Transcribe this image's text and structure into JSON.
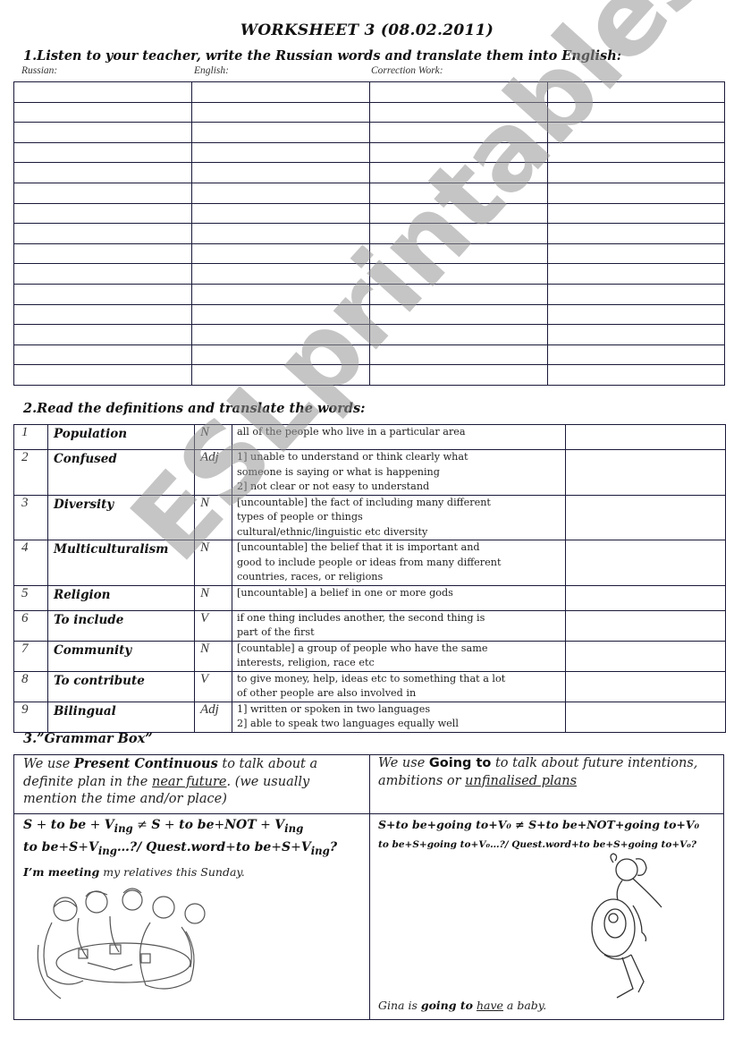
{
  "title": "WORKSHEET 3 (08.02.2011)",
  "section1": {
    "heading": "1.Listen to your teacher, write the Russian words and translate them into English:",
    "column_labels": [
      "Russian:",
      "English:",
      "Correction Work:",
      ""
    ],
    "row_count": 15,
    "column_count": 4
  },
  "section2": {
    "heading": "2.Read the definitions and translate the words:",
    "rows": [
      {
        "num": "1",
        "word": "Population",
        "pos": "N",
        "definition": "all of the people who live in a particular area",
        "translation": ""
      },
      {
        "num": "2",
        "word": "Confused",
        "pos": "Adj",
        "definition": "1] unable to understand or think clearly what\nsomeone is saying or what is happening\n 2] not clear or not easy to understand",
        "translation": ""
      },
      {
        "num": "3",
        "word": "Diversity",
        "pos": "N",
        "definition": " [uncountable] the fact of including many different\ntypes of people or things\ncultural/ethnic/linguistic etc diversity",
        "translation": ""
      },
      {
        "num": "4",
        "word": "Multiculturalism",
        "pos": "N",
        "definition": "[uncountable] the belief that it is important and\ngood to include people or ideas from many different\ncountries, races, or religions",
        "translation": ""
      },
      {
        "num": "5",
        "word": "Religion",
        "pos": "N",
        "definition": " [uncountable] a belief in one or more gods",
        "translation": ""
      },
      {
        "num": "6",
        "word": "To include",
        "pos": "V",
        "definition": "if one thing includes another, the second thing is\npart of the first",
        "translation": ""
      },
      {
        "num": "7",
        "word": "Community",
        "pos": "N",
        "definition": " [countable] a group of people who have the same\ninterests, religion, race etc",
        "translation": ""
      },
      {
        "num": "8",
        "word": "To contribute",
        "pos": "V",
        "definition": "to give money, help, ideas etc to something that a lot\nof other people are also involved in",
        "translation": ""
      },
      {
        "num": "9",
        "word": "Bilingual",
        "pos": "Adj",
        "definition": " 1]   written or spoken in two languages\n 2]   able to speak two languages equally well",
        "translation": ""
      }
    ]
  },
  "section3": {
    "heading": "3.”Grammar Box”",
    "left": {
      "intro_pre": "We use ",
      "intro_bold": "Present Continuous",
      "intro_mid": " to talk about a definite plan in the ",
      "intro_underline": "near future",
      "intro_post": ". (we usually mention the time and/or place)",
      "formula1": {
        "a": "S",
        "b": " + ",
        "c": "to be",
        "d": " + ",
        "e": "V",
        "e_sub": "ing",
        "f": " ≠ ",
        "g": "S",
        "h": " + ",
        "i": "to be",
        "j": "+",
        "k": "NOT",
        "l": " + ",
        "m": "V",
        "m_sub": "ing"
      },
      "formula2": {
        "a": "to be",
        "b": "+",
        "c": "S",
        "d": "+",
        "e": "V",
        "e_sub": "ing",
        "f": "…?/ ",
        "g": "Quest.word",
        "h": "+",
        "i": "to be",
        "j": "+",
        "k": "S",
        "l": "+",
        "m": "V",
        "m_sub": "ing",
        "n": "?"
      },
      "example_bold": "I’m meeting",
      "example_rest": " my relatives this Sunday.",
      "illustration": "family-dinner-illustration"
    },
    "right": {
      "intro_pre": "We use ",
      "intro_bold": "Going to",
      "intro_mid": " to talk about future intentions, ambitions or ",
      "intro_underline": "unfinalised plans",
      "formula1": "S+to be+going to+V₀ ≠ S+to be+NOT+going to+V₀",
      "formula2": "to be+S+going to+V₀…?/ Quest.word+to be+S+going to+V₀?",
      "example_pre": "Gina is ",
      "example_bold": "going to",
      "example_space": " ",
      "example_underline": "have",
      "example_post": " a baby.",
      "illustration": "pregnant-woman-illustration"
    }
  },
  "watermark": "ESLprintables.com"
}
